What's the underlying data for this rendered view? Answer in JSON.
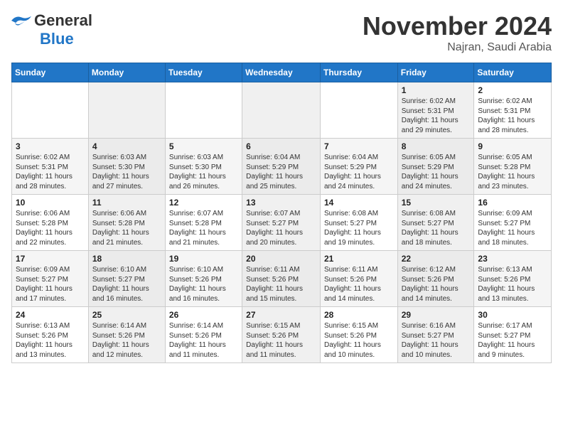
{
  "header": {
    "logo_line1": "General",
    "logo_line2": "Blue",
    "month": "November 2024",
    "location": "Najran, Saudi Arabia"
  },
  "weekdays": [
    "Sunday",
    "Monday",
    "Tuesday",
    "Wednesday",
    "Thursday",
    "Friday",
    "Saturday"
  ],
  "weeks": [
    [
      {
        "day": "",
        "info": ""
      },
      {
        "day": "",
        "info": ""
      },
      {
        "day": "",
        "info": ""
      },
      {
        "day": "",
        "info": ""
      },
      {
        "day": "",
        "info": ""
      },
      {
        "day": "1",
        "info": "Sunrise: 6:02 AM\nSunset: 5:31 PM\nDaylight: 11 hours\nand 29 minutes."
      },
      {
        "day": "2",
        "info": "Sunrise: 6:02 AM\nSunset: 5:31 PM\nDaylight: 11 hours\nand 28 minutes."
      }
    ],
    [
      {
        "day": "3",
        "info": "Sunrise: 6:02 AM\nSunset: 5:31 PM\nDaylight: 11 hours\nand 28 minutes."
      },
      {
        "day": "4",
        "info": "Sunrise: 6:03 AM\nSunset: 5:30 PM\nDaylight: 11 hours\nand 27 minutes."
      },
      {
        "day": "5",
        "info": "Sunrise: 6:03 AM\nSunset: 5:30 PM\nDaylight: 11 hours\nand 26 minutes."
      },
      {
        "day": "6",
        "info": "Sunrise: 6:04 AM\nSunset: 5:29 PM\nDaylight: 11 hours\nand 25 minutes."
      },
      {
        "day": "7",
        "info": "Sunrise: 6:04 AM\nSunset: 5:29 PM\nDaylight: 11 hours\nand 24 minutes."
      },
      {
        "day": "8",
        "info": "Sunrise: 6:05 AM\nSunset: 5:29 PM\nDaylight: 11 hours\nand 24 minutes."
      },
      {
        "day": "9",
        "info": "Sunrise: 6:05 AM\nSunset: 5:28 PM\nDaylight: 11 hours\nand 23 minutes."
      }
    ],
    [
      {
        "day": "10",
        "info": "Sunrise: 6:06 AM\nSunset: 5:28 PM\nDaylight: 11 hours\nand 22 minutes."
      },
      {
        "day": "11",
        "info": "Sunrise: 6:06 AM\nSunset: 5:28 PM\nDaylight: 11 hours\nand 21 minutes."
      },
      {
        "day": "12",
        "info": "Sunrise: 6:07 AM\nSunset: 5:28 PM\nDaylight: 11 hours\nand 21 minutes."
      },
      {
        "day": "13",
        "info": "Sunrise: 6:07 AM\nSunset: 5:27 PM\nDaylight: 11 hours\nand 20 minutes."
      },
      {
        "day": "14",
        "info": "Sunrise: 6:08 AM\nSunset: 5:27 PM\nDaylight: 11 hours\nand 19 minutes."
      },
      {
        "day": "15",
        "info": "Sunrise: 6:08 AM\nSunset: 5:27 PM\nDaylight: 11 hours\nand 18 minutes."
      },
      {
        "day": "16",
        "info": "Sunrise: 6:09 AM\nSunset: 5:27 PM\nDaylight: 11 hours\nand 18 minutes."
      }
    ],
    [
      {
        "day": "17",
        "info": "Sunrise: 6:09 AM\nSunset: 5:27 PM\nDaylight: 11 hours\nand 17 minutes."
      },
      {
        "day": "18",
        "info": "Sunrise: 6:10 AM\nSunset: 5:27 PM\nDaylight: 11 hours\nand 16 minutes."
      },
      {
        "day": "19",
        "info": "Sunrise: 6:10 AM\nSunset: 5:26 PM\nDaylight: 11 hours\nand 16 minutes."
      },
      {
        "day": "20",
        "info": "Sunrise: 6:11 AM\nSunset: 5:26 PM\nDaylight: 11 hours\nand 15 minutes."
      },
      {
        "day": "21",
        "info": "Sunrise: 6:11 AM\nSunset: 5:26 PM\nDaylight: 11 hours\nand 14 minutes."
      },
      {
        "day": "22",
        "info": "Sunrise: 6:12 AM\nSunset: 5:26 PM\nDaylight: 11 hours\nand 14 minutes."
      },
      {
        "day": "23",
        "info": "Sunrise: 6:13 AM\nSunset: 5:26 PM\nDaylight: 11 hours\nand 13 minutes."
      }
    ],
    [
      {
        "day": "24",
        "info": "Sunrise: 6:13 AM\nSunset: 5:26 PM\nDaylight: 11 hours\nand 13 minutes."
      },
      {
        "day": "25",
        "info": "Sunrise: 6:14 AM\nSunset: 5:26 PM\nDaylight: 11 hours\nand 12 minutes."
      },
      {
        "day": "26",
        "info": "Sunrise: 6:14 AM\nSunset: 5:26 PM\nDaylight: 11 hours\nand 11 minutes."
      },
      {
        "day": "27",
        "info": "Sunrise: 6:15 AM\nSunset: 5:26 PM\nDaylight: 11 hours\nand 11 minutes."
      },
      {
        "day": "28",
        "info": "Sunrise: 6:15 AM\nSunset: 5:26 PM\nDaylight: 11 hours\nand 10 minutes."
      },
      {
        "day": "29",
        "info": "Sunrise: 6:16 AM\nSunset: 5:27 PM\nDaylight: 11 hours\nand 10 minutes."
      },
      {
        "day": "30",
        "info": "Sunrise: 6:17 AM\nSunset: 5:27 PM\nDaylight: 11 hours\nand 9 minutes."
      }
    ]
  ]
}
